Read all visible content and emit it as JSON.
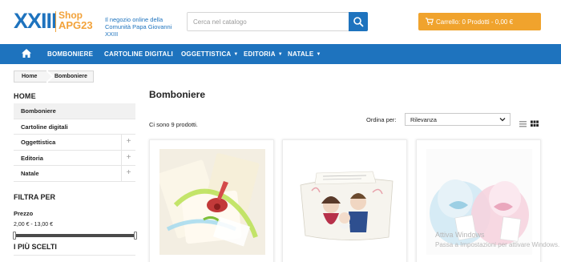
{
  "header": {
    "logo_main": "XXIII",
    "logo_shop": "Shop",
    "logo_apg": "APG23",
    "tagline_line1": "Il negozio online della",
    "tagline_line2": "Comunità Papa Giovanni XXIII",
    "search_placeholder": "Cerca nel catalogo",
    "cart_label": "Carrello: 0 Prodotti - 0,00 €"
  },
  "nav": {
    "home_icon": "home-icon",
    "items": [
      {
        "label": "BOMBONIERE"
      },
      {
        "label": "CARTOLINE DIGITALI"
      },
      {
        "label": "OGGETTISTICA"
      },
      {
        "label": "EDITORIA"
      },
      {
        "label": "NATALE"
      }
    ]
  },
  "breadcrumb": [
    "Home",
    "Bomboniere"
  ],
  "sidebar": {
    "title": "HOME",
    "items": [
      {
        "label": "Bomboniere"
      },
      {
        "label": "Cartoline digitali"
      },
      {
        "label": "Oggettistica"
      },
      {
        "label": "Editoria"
      },
      {
        "label": "Natale"
      }
    ],
    "filter_title": "FILTRA PER",
    "price_label": "Prezzo",
    "price_range": "2,00 € - 13,00 €",
    "price_slider": {
      "min": 2,
      "max": 13
    },
    "bestsellers_title": "I PIÙ SCELTI"
  },
  "main": {
    "title": "Bomboniere",
    "count": "Ci sono 9 prodotti.",
    "sort_label": "Ordina per:",
    "sort_value": "Rilevanza",
    "view_icons": [
      "list-view-icon",
      "grid-view-icon"
    ]
  },
  "watermark": {
    "line1": "Attiva Windows",
    "line2": "Passa a Impostazioni per attivare Windows."
  },
  "colors": {
    "brand_blue": "#1e73be",
    "accent_orange": "#f0a32d"
  }
}
